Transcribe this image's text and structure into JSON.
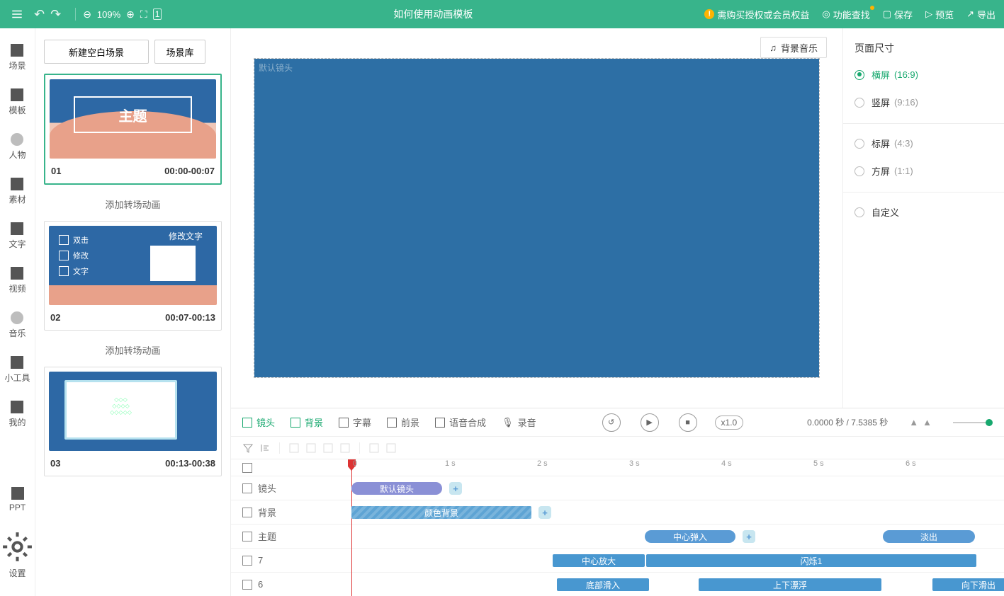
{
  "header": {
    "zoom_pct": "109%",
    "title": "如何使用动画模板",
    "warn": "需购买授权或会员权益",
    "feature_search": "功能查找",
    "save": "保存",
    "preview": "预览",
    "export": "导出"
  },
  "leftnav": {
    "scene": "场景",
    "template": "模板",
    "character": "人物",
    "material": "素材",
    "text": "文字",
    "video": "视频",
    "audio": "音乐",
    "widget": "小工具",
    "mine": "我的",
    "ppt": "PPT",
    "settings": "设置"
  },
  "scenes": {
    "new_blank": "新建空白场景",
    "library": "场景库",
    "add_transition": "添加转场动画",
    "items": [
      {
        "index": "01",
        "time": "00:00-00:07",
        "title": "主题"
      },
      {
        "index": "02",
        "time": "00:07-00:13",
        "title": "修改文字",
        "rows": [
          "双击",
          "修改",
          "文字"
        ]
      },
      {
        "index": "03",
        "time": "00:13-00:38"
      }
    ]
  },
  "canvas": {
    "bgm": "背景音乐",
    "camera_label": "默认镜头"
  },
  "rightpanel": {
    "heading": "页面尺寸",
    "options": [
      {
        "label": "横屏",
        "ratio": "(16:9)",
        "active": true
      },
      {
        "label": "竖屏",
        "ratio": "(9:16)"
      },
      {
        "label": "标屏",
        "ratio": "(4:3)"
      },
      {
        "label": "方屏",
        "ratio": "(1:1)"
      },
      {
        "label": "自定义"
      }
    ]
  },
  "timeline": {
    "tabs": {
      "camera": "镜头",
      "background": "背景",
      "subtitle": "字幕",
      "foreground": "前景",
      "tts": "语音合成",
      "record": "录音"
    },
    "speed": "x1.0",
    "time_display": "0.0000 秒 / 7.5385 秒",
    "ruler": [
      "0",
      "1 s",
      "2 s",
      "3 s",
      "4 s",
      "5 s",
      "6 s"
    ],
    "rows": {
      "camera": {
        "label": "镜头",
        "clip": "默认镜头"
      },
      "background": {
        "label": "背景",
        "clip": "颜色背景"
      },
      "theme": {
        "label": "主题",
        "clip1": "中心弹入",
        "clip2": "淡出"
      },
      "r7": {
        "label": "7",
        "clip1": "中心放大",
        "clip2": "闪烁1"
      },
      "r6": {
        "label": "6",
        "clip1": "底部滑入",
        "clip2": "上下漂浮",
        "clip3": "向下滑出"
      }
    }
  }
}
